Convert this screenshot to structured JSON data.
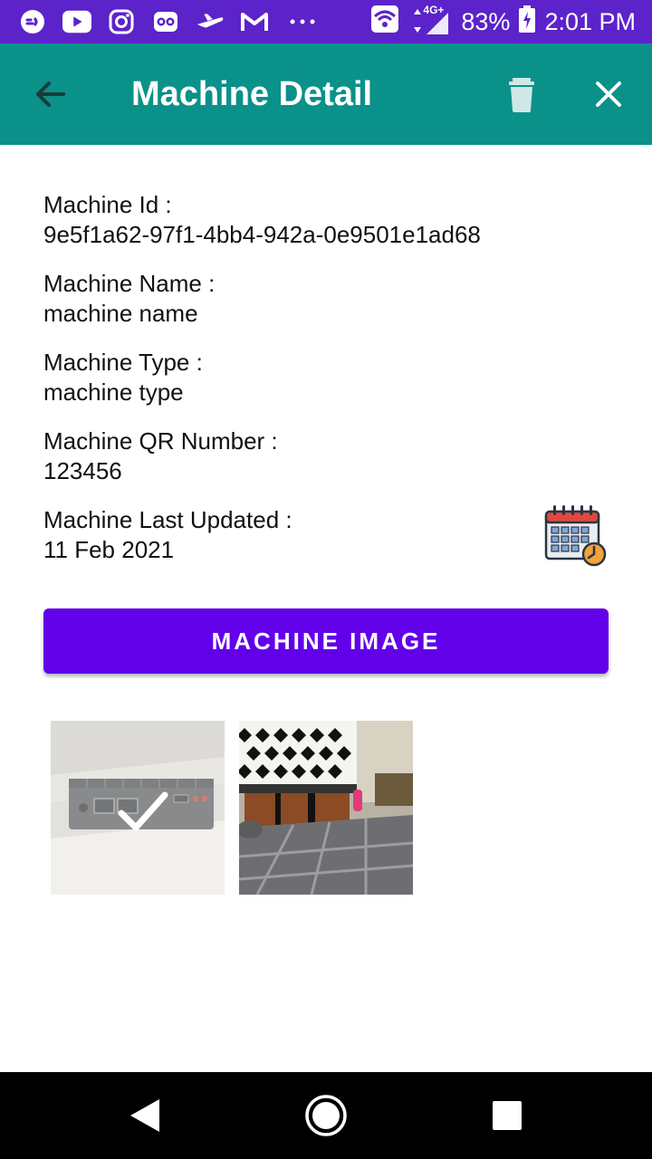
{
  "status_bar": {
    "battery": "83%",
    "time": "2:01 PM",
    "network": "4G+",
    "icons": [
      "messenger-icon",
      "youtube-icon",
      "instagram-icon",
      "tripadvisor-icon",
      "airplane-icon",
      "gmail-icon",
      "more-dots-icon",
      "wifi-icon",
      "signal-icon",
      "battery-icon"
    ]
  },
  "app_bar": {
    "title": "Machine Detail",
    "color": "#0a9189"
  },
  "details": [
    {
      "label": "Machine Id :",
      "value": "9e5f1a62-97f1-4bb4-942a-0e9501e1ad68"
    },
    {
      "label": "Machine Name :",
      "value": "machine name"
    },
    {
      "label": "Machine Type :",
      "value": "machine type"
    },
    {
      "label": "Machine QR Number :",
      "value": "123456"
    },
    {
      "label": "Machine Last Updated :",
      "value": "11 Feb 2021"
    }
  ],
  "machine_image_button": {
    "label": "MACHINE IMAGE",
    "color": "#6200ea"
  },
  "images": [
    {
      "name": "mini-pc-photo",
      "selected": true
    },
    {
      "name": "kitchen-room-photo",
      "selected": false
    }
  ]
}
